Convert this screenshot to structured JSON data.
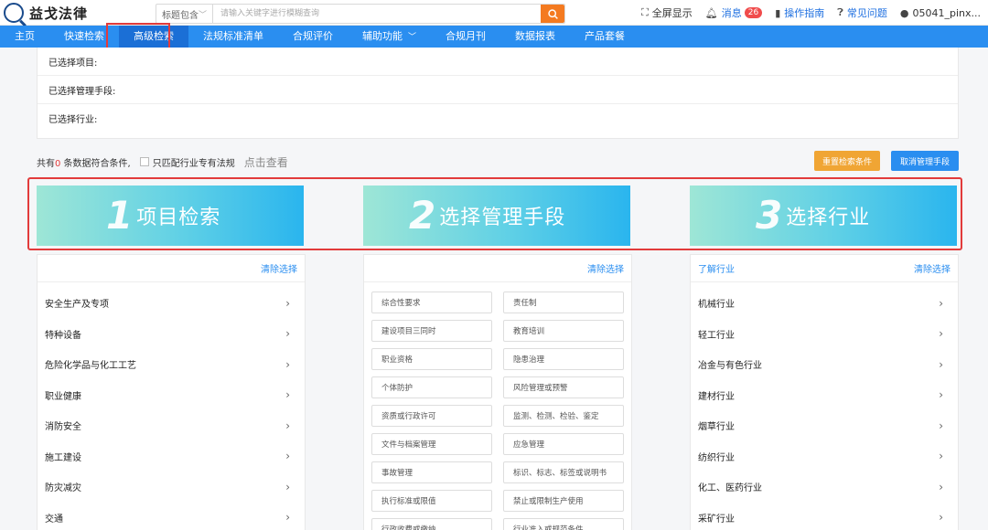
{
  "brand": {
    "name": "益戈法律"
  },
  "search": {
    "scope": "标题包含",
    "placeholder": "请输入关键字进行模糊查询"
  },
  "top_actions": {
    "fullscreen": "全屏显示",
    "messages": "消息",
    "message_count": "26",
    "guide": "操作指南",
    "faq": "常见问题",
    "user": "05041_pinx..."
  },
  "nav": {
    "items": [
      "主页",
      "快速检索",
      "高级检索",
      "法规标准清单",
      "合规评价",
      "辅助功能",
      "合规月刊",
      "数据报表",
      "产品套餐"
    ],
    "active_index": 2
  },
  "criteria": {
    "rows": [
      "已选择项目:",
      "已选择管理手段:",
      "已选择行业:"
    ]
  },
  "result": {
    "prefix": "共有",
    "count": "0",
    "suffix": " 条数据符合条件,",
    "checkbox_label": "只匹配行业专有法规",
    "view_link": "点击查看",
    "reset_button": "重置检索条件",
    "cancel_button": "取消管理手段"
  },
  "steps": [
    {
      "num": "1",
      "title": "项目检索"
    },
    {
      "num": "2",
      "title": "选择管理手段"
    },
    {
      "num": "3",
      "title": "选择行业"
    }
  ],
  "projects": {
    "clear": "清除选择",
    "items": [
      "安全生产及专项",
      "特种设备",
      "危险化学品与化工工艺",
      "职业健康",
      "消防安全",
      "施工建设",
      "防灾减灾",
      "交通"
    ]
  },
  "means": {
    "clear": "清除选择",
    "items": [
      "综合性要求",
      "责任制",
      "建设项目三同时",
      "教育培训",
      "职业资格",
      "隐患治理",
      "个体防护",
      "风险管理或预警",
      "资质或行政许可",
      "监测、检测、检验、鉴定",
      "文件与档案管理",
      "应急管理",
      "事故管理",
      "标识、标志、标签或说明书",
      "执行标准或限值",
      "禁止或限制生产使用",
      "行政收费或缴纳",
      "行业准入或规范条件"
    ]
  },
  "industries": {
    "learn": "了解行业",
    "clear": "清除选择",
    "items": [
      "机械行业",
      "轻工行业",
      "冶金与有色行业",
      "建材行业",
      "烟草行业",
      "纺织行业",
      "化工、医药行业",
      "采矿行业"
    ]
  },
  "colors": {
    "nav_bg": "#2a8ef0",
    "accent_orange": "#f47a20",
    "highlight_red": "#e23b3b",
    "link_blue": "#2a8ef0"
  }
}
